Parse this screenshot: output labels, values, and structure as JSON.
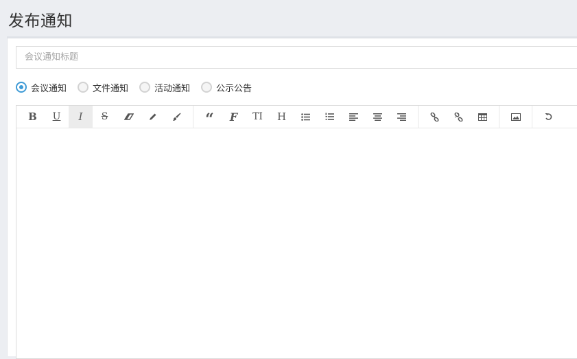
{
  "page": {
    "title": "发布通知"
  },
  "form": {
    "title_input": {
      "placeholder": "会议通知标题",
      "value": ""
    },
    "notice_types": [
      {
        "label": "会议通知",
        "checked": true
      },
      {
        "label": "文件通知",
        "checked": false
      },
      {
        "label": "活动通知",
        "checked": false
      },
      {
        "label": "公示公告",
        "checked": false
      }
    ]
  },
  "editor": {
    "toolbar": {
      "bold": "B",
      "underline": "U",
      "italic": "I",
      "strikethrough": "S",
      "quote": "“",
      "font": "F",
      "font_size": "TI",
      "heading": "H"
    },
    "content": ""
  },
  "colors": {
    "accent": "#3f9bd6",
    "background": "#eceef2"
  }
}
